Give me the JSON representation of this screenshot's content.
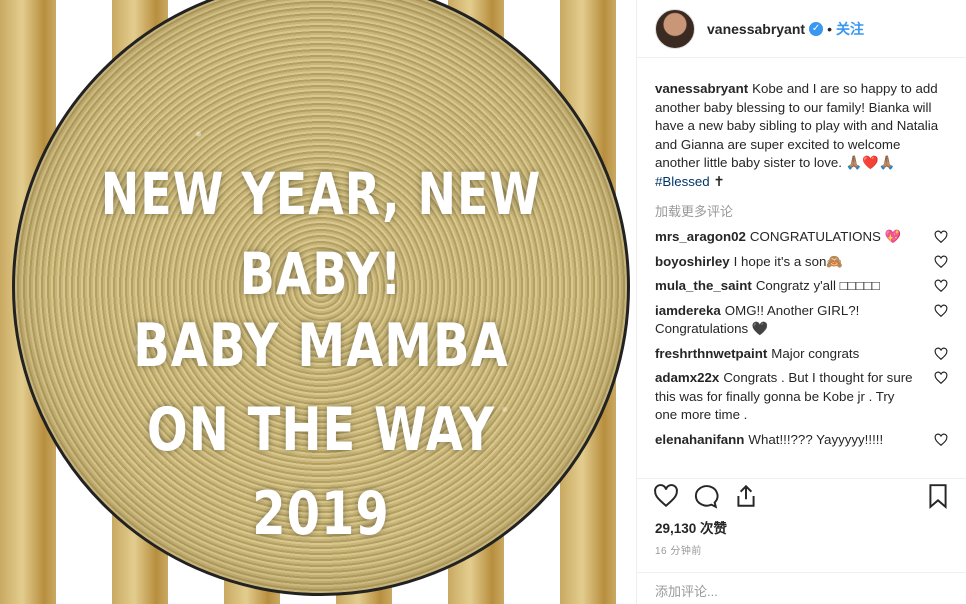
{
  "image": {
    "line1": "NEW YEAR, NEW BABY!",
    "line2": "BABY MAMBA",
    "line3": "ON THE WAY",
    "line4": "2019"
  },
  "header": {
    "username": "vanessabryant",
    "separator": "•",
    "follow": "关注"
  },
  "caption": {
    "username": "vanessabryant",
    "text": "Kobe and I are so happy to add another baby blessing to our family! Bianka will have a new baby sibling to play with and Natalia and Gianna are super excited to welcome another little baby sister to love. 🙏🏽❤️🙏🏽 ",
    "hashtag": "#Blessed",
    "tail": " ✝"
  },
  "load_more": "加载更多评论",
  "comments": [
    {
      "user": "mrs_aragon02",
      "text": "CONGRATULATIONS 💖"
    },
    {
      "user": "boyoshirley",
      "text": "I hope it's a son🙈"
    },
    {
      "user": "mula_the_saint",
      "text": "Congratz y'all □□□□□"
    },
    {
      "user": "iamdereka",
      "text": "OMG!! Another GIRL?! Congratulations 🖤"
    },
    {
      "user": "freshrthnwetpaint",
      "text": "Major congrats"
    },
    {
      "user": "adamx22x",
      "text": "Congrats . But I thought for sure this was for finally gonna be Kobe jr . Try one more time ."
    },
    {
      "user": "elenahanifann",
      "text": "What!!!??? Yayyyyy!!!!!"
    }
  ],
  "likes": "29,130 次赞",
  "time": "16 分钟前",
  "add_comment": "添加评论...",
  "colors": {
    "link": "#3897f0",
    "hashtag": "#003569",
    "muted": "#999999"
  }
}
